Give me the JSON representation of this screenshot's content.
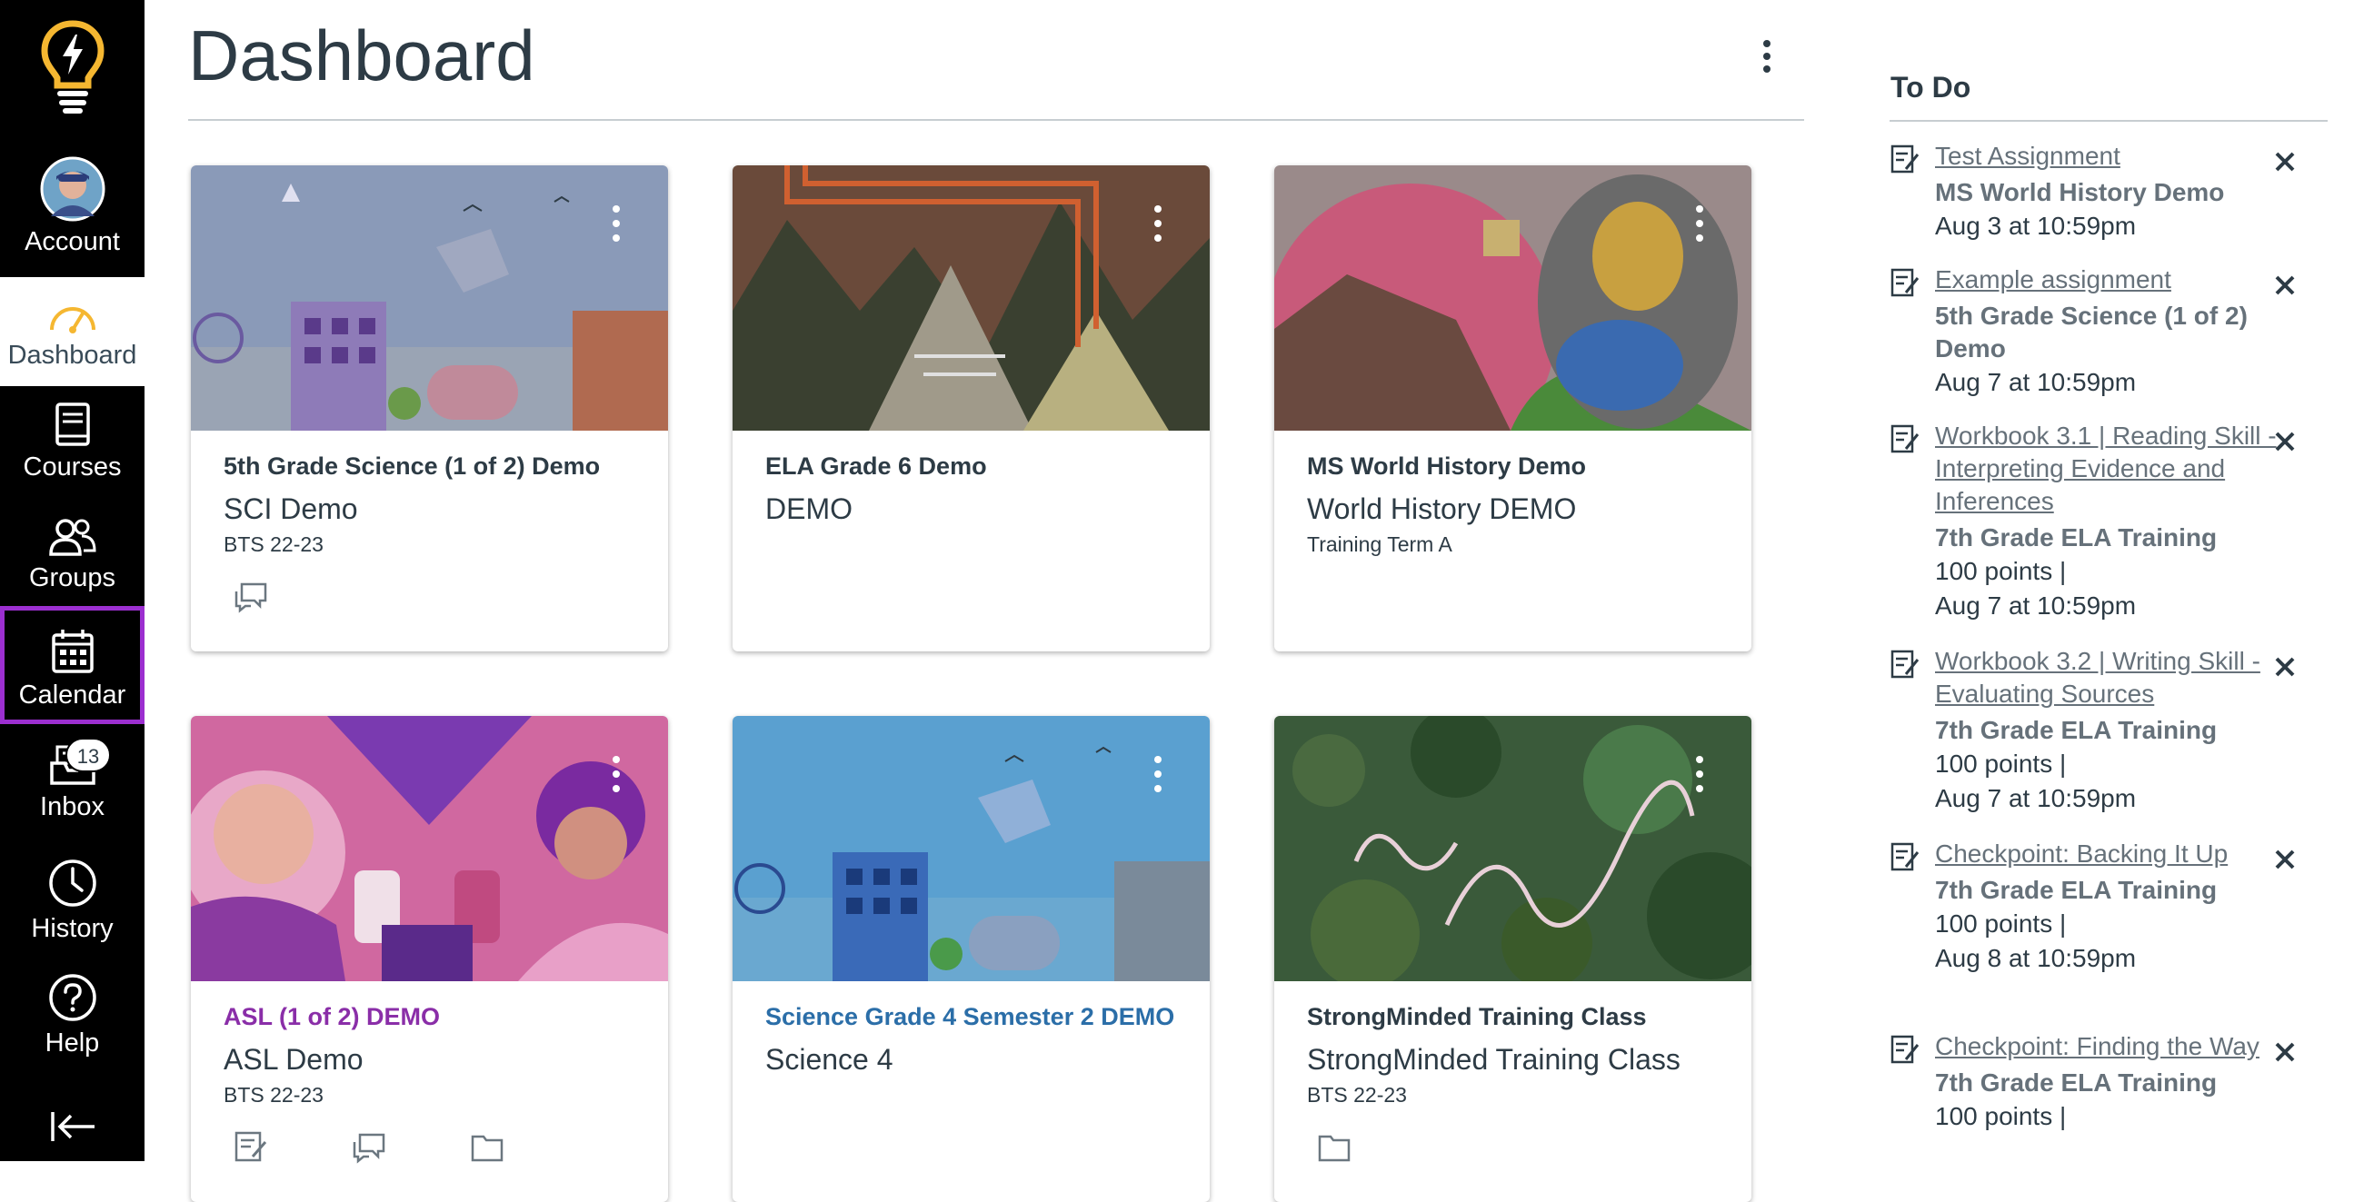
{
  "nav": {
    "account": "Account",
    "dashboard": "Dashboard",
    "courses": "Courses",
    "groups": "Groups",
    "calendar": "Calendar",
    "inbox": "Inbox",
    "inbox_badge": "13",
    "history": "History",
    "help": "Help"
  },
  "page": {
    "title": "Dashboard"
  },
  "cards": [
    {
      "title": "5th Grade Science (1 of 2) Demo",
      "code": "SCI Demo",
      "term": "BTS 22-23",
      "title_color": "#2d3b45",
      "icons": [
        "discussions-icon"
      ]
    },
    {
      "title": "ELA Grade 6 Demo",
      "code": "DEMO",
      "term": "",
      "title_color": "#2d3b45",
      "icons": []
    },
    {
      "title": "MS World History Demo",
      "code": "World History DEMO",
      "term": "Training Term A",
      "title_color": "#2d3b45",
      "icons": []
    },
    {
      "title": "ASL (1 of 2) DEMO",
      "code": "ASL Demo",
      "term": "BTS 22-23",
      "title_color": "#8a2ea8",
      "icons": [
        "assignments-icon",
        "discussions-icon",
        "files-icon"
      ]
    },
    {
      "title": "Science Grade 4 Semester 2 DEMO",
      "code": "Science 4",
      "term": "",
      "title_color": "#2b6ea8",
      "icons": []
    },
    {
      "title": "StrongMinded Training Class",
      "code": "StrongMinded Training Class",
      "term": "BTS 22-23",
      "title_color": "#2d3b45",
      "icons": [
        "files-icon"
      ]
    }
  ],
  "todo": {
    "title": "To Do",
    "items": [
      {
        "link": "Test Assignment",
        "course": "MS World History Demo",
        "points": "",
        "due": "Aug 3 at 10:59pm"
      },
      {
        "link": "Example assignment",
        "course": "5th Grade Science (1 of 2) Demo",
        "points": "",
        "due": "Aug 7 at 10:59pm"
      },
      {
        "link": "Workbook 3.1 | Reading Skill - Interpreting Evidence and Inferences",
        "course": "7th Grade ELA Training",
        "points": "100 points  |",
        "due": "Aug 7 at 10:59pm"
      },
      {
        "link": "Workbook 3.2 | Writing Skill - Evaluating Sources",
        "course": "7th Grade ELA Training",
        "points": "100 points  |",
        "due": "Aug 7 at 10:59pm"
      },
      {
        "link": "Checkpoint: Backing It Up",
        "course": "7th Grade ELA Training",
        "points": "100 points  |",
        "due": "Aug 8 at 10:59pm"
      },
      {
        "link": "Checkpoint: Finding the Way",
        "course": "7th Grade ELA Training",
        "points": "100 points  |",
        "due": ""
      }
    ]
  },
  "colors": {
    "nav_bg": "#000000",
    "active_outline": "#9c2fd0",
    "logo": "#f5b731"
  }
}
